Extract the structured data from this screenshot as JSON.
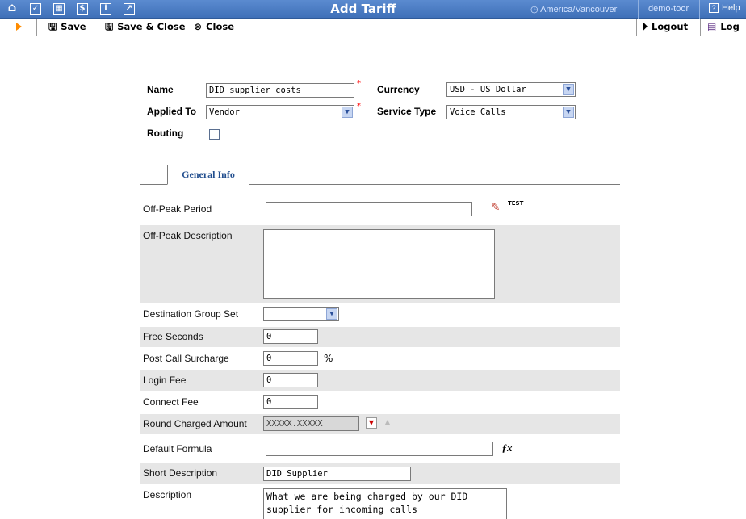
{
  "window": {
    "title": "Add Tariff",
    "timezone": "America/Vancouver",
    "user": "demo-toor",
    "help_label": "Help",
    "help_box": "?"
  },
  "titlebar_icons": [
    "home-icon",
    "checkmark-icon",
    "grid-icon",
    "dollar-icon",
    "info-icon",
    "chart-icon"
  ],
  "toolbar": {
    "save_label": "Save",
    "save_close_label": "Save & Close",
    "close_label": "Close",
    "logout_label": "Logout",
    "log_label": "Log"
  },
  "header": {
    "name_label": "Name",
    "name_value": "DID supplier costs",
    "currency_label": "Currency",
    "currency_value": "USD - US Dollar",
    "applied_to_label": "Applied To",
    "applied_to_value": "Vendor",
    "service_type_label": "Service Type",
    "service_type_value": "Voice Calls",
    "routing_label": "Routing",
    "required_mark": "*"
  },
  "tabs": [
    {
      "label": "General Info",
      "active": true
    }
  ],
  "general": {
    "off_peak_period_label": "Off-Peak Period",
    "off_peak_period_value": "",
    "off_peak_description_label": "Off-Peak Description",
    "off_peak_description_value": "",
    "destination_group_set_label": "Destination Group Set",
    "destination_group_set_value": "",
    "free_seconds_label": "Free Seconds",
    "free_seconds_value": "0",
    "post_call_surcharge_label": "Post Call Surcharge",
    "post_call_surcharge_value": "0",
    "percent_sign": "%",
    "login_fee_label": "Login Fee",
    "login_fee_value": "0",
    "connect_fee_label": "Connect Fee",
    "connect_fee_value": "0",
    "round_charged_amount_label": "Round Charged Amount",
    "round_charged_amount_value": "XXXXX.XXXXX",
    "default_formula_label": "Default Formula",
    "default_formula_value": "",
    "short_description_label": "Short Description",
    "short_description_value": "DID Supplier",
    "description_label": "Description",
    "description_value": "What we are being charged by our DID supplier for incoming calls",
    "test_label": "TEST"
  },
  "colors": {
    "titlebar": "#4a7bc4",
    "shaded_row": "#e6e6e6",
    "tab_text": "#234f8f",
    "required": "#ff0000",
    "play_arrow": "#ff8c00"
  }
}
